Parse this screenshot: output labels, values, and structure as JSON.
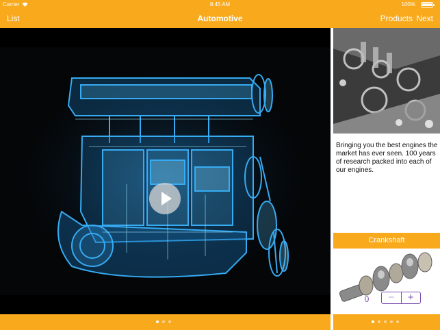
{
  "status_bar": {
    "carrier": "Carrier",
    "time": "8:45 AM",
    "battery": "100%",
    "battery_level": 1.0,
    "wifi_icon": "wifi-icon",
    "battery_icon": "battery-icon"
  },
  "nav": {
    "left": "List",
    "title": "Automotive",
    "right_products": "Products",
    "right_next": "Next"
  },
  "video": {
    "play_icon": "play-icon",
    "pages": {
      "count": 3,
      "active": 0
    }
  },
  "sidebar": {
    "description": "Bringing you the best engines the market has ever seen. 100 years of research packed into each of our engines.",
    "product_name": "Crankshaft",
    "quantity": "0",
    "stepper": {
      "minus": "−",
      "plus": "+"
    },
    "pages": {
      "count": 5,
      "active": 0
    }
  },
  "colors": {
    "accent": "#f9a91c",
    "stepper": "#7a4fb0",
    "engine_glow": "#3ab4ff"
  }
}
